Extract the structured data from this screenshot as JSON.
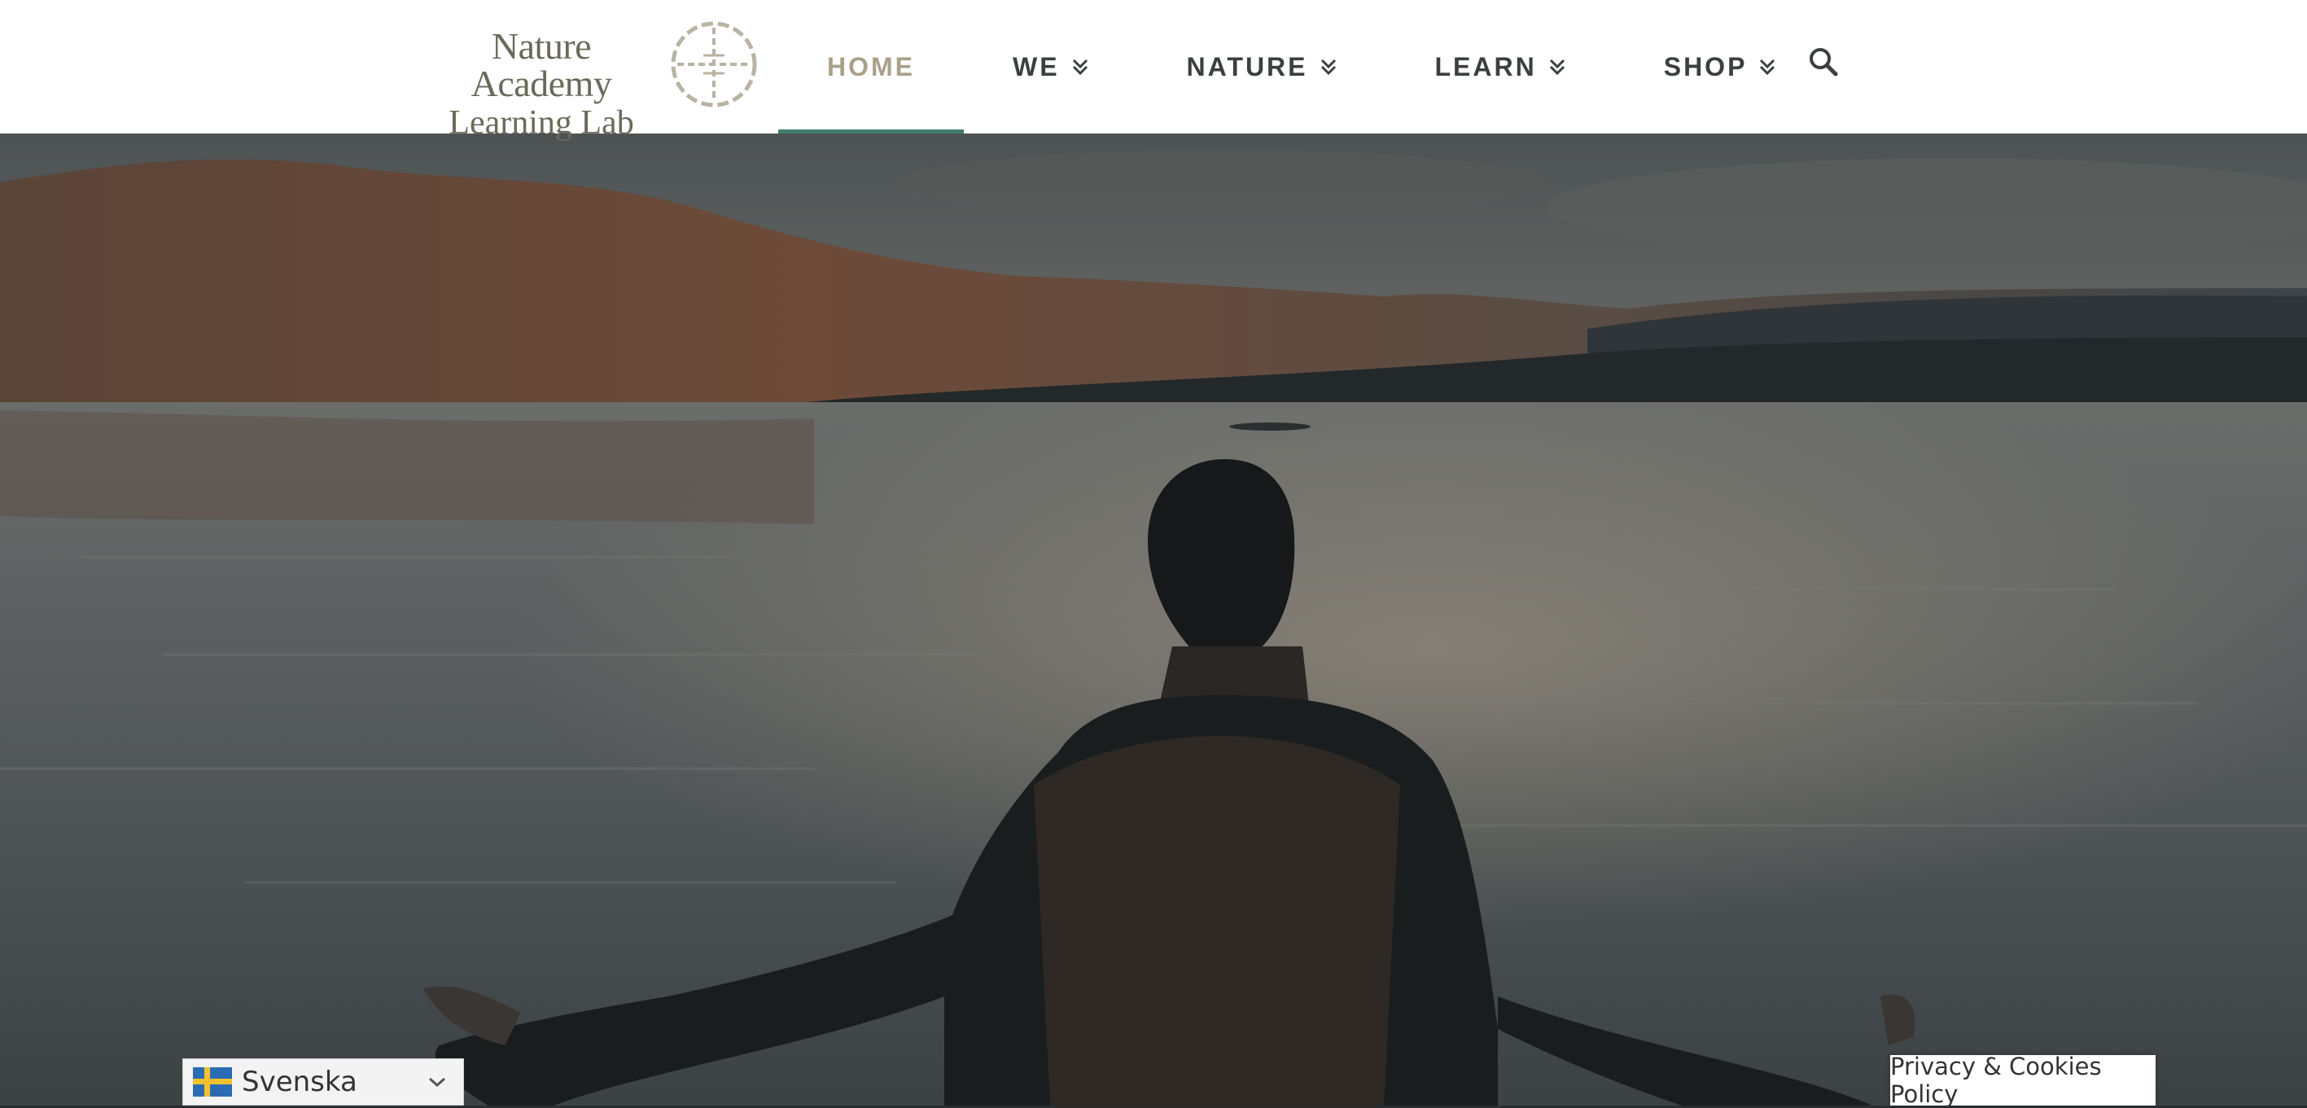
{
  "header": {
    "logo": {
      "line1": "Nature Academy",
      "line2": "Learning Lab"
    },
    "nav": [
      {
        "label": "HOME",
        "active": true
      },
      {
        "label": "WE",
        "dropdown": true
      },
      {
        "label": "NATURE",
        "dropdown": true
      },
      {
        "label": "LEARN",
        "dropdown": true
      },
      {
        "label": "SHOP",
        "dropdown": true
      }
    ],
    "search_icon": "search-icon"
  },
  "language": {
    "selected": "Svenska",
    "flag": "swedish-flag-icon"
  },
  "footer": {
    "privacy_label": "Privacy & Cookies Policy"
  },
  "colors": {
    "nav_text": "#3b3f3e",
    "nav_active": "#a9a08a",
    "active_underline": "#3f7f6e",
    "logo": "#6b6a5a"
  }
}
